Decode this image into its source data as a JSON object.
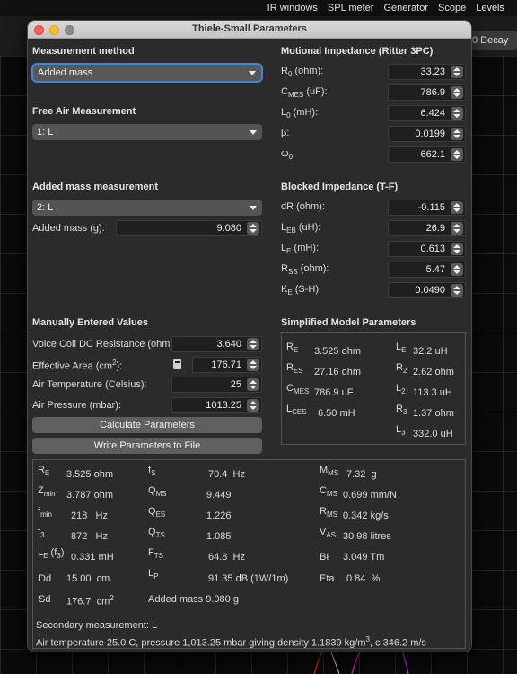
{
  "menubar": [
    "IR windows",
    "SPL meter",
    "Generator",
    "Scope",
    "Levels"
  ],
  "toolbar": {
    "decay_label": "0 Decay"
  },
  "dialog": {
    "title": "Thiele-Small Parameters",
    "measurement_method": {
      "heading": "Measurement method",
      "value": "Added mass"
    },
    "free_air": {
      "heading": "Free Air Measurement",
      "value": "1: L"
    },
    "added_mass": {
      "heading": "Added mass measurement",
      "value": "2: L",
      "mass_label": "Added mass (g):",
      "mass_value": "9.080"
    },
    "manual": {
      "heading": "Manually Entered Values",
      "dc_label": "Voice Coil DC Resistance (ohm):",
      "dc_value": "3.640",
      "area_label_pre": "Effective Area (cm",
      "area_label_sup": "2",
      "area_label_post": "):",
      "area_value": "176.71",
      "temp_label": "Air Temperature (Celsius):",
      "temp_value": "25",
      "pressure_label": "Air Pressure (mbar):",
      "pressure_value": "1013.25",
      "calc_button": "Calculate Parameters",
      "write_button": "Write Parameters to File"
    },
    "motional": {
      "heading": "Motional Impedance (Ritter 3PC)",
      "r0": {
        "pre": "R",
        "sub": "0",
        "post": " (ohm):",
        "value": "33.23"
      },
      "cmes": {
        "pre": "C",
        "sub": "MES",
        "post": " (uF):",
        "value": "786.9"
      },
      "l0": {
        "pre": "L",
        "sub": "0",
        "post": " (mH):",
        "value": "6.424"
      },
      "beta": {
        "pre": "β:",
        "sub": "",
        "post": "",
        "value": "0.0199"
      },
      "omega": {
        "pre": "ω",
        "sub": "0",
        "post": ":",
        "value": "662.1"
      }
    },
    "blocked": {
      "heading": "Blocked Impedance (T-F)",
      "dr": {
        "pre": "dR (ohm):",
        "sub": "",
        "post": "",
        "value": "-0.115"
      },
      "leb": {
        "pre": "L",
        "sub": "EB",
        "post": " (uH):",
        "value": "26.9"
      },
      "le": {
        "pre": "L",
        "sub": "E",
        "post": " (mH):",
        "value": "0.613"
      },
      "rss": {
        "pre": "R",
        "sub": "SS",
        "post": " (ohm):",
        "value": "5.47"
      },
      "ke": {
        "pre": "K",
        "sub": "E",
        "post": " (S-H):",
        "value": "0.0490"
      }
    },
    "simplified": {
      "heading": "Simplified Model Parameters",
      "re": {
        "pre": "R",
        "sub": "E",
        "value": "3.525",
        "unit": "ohm"
      },
      "res": {
        "pre": "R",
        "sub": "ES",
        "value": "27.16",
        "unit": "ohm"
      },
      "cmes": {
        "pre": "C",
        "sub": "MES",
        "value": "786.9",
        "unit": "uF"
      },
      "lces": {
        "pre": "L",
        "sub": "CES",
        "value": "6.50",
        "unit": "mH"
      },
      "le": {
        "pre": "L",
        "sub": "E",
        "value": "32.2",
        "unit": "uH"
      },
      "r2": {
        "pre": "R",
        "sub": "2",
        "value": "2.62",
        "unit": "ohm"
      },
      "l2": {
        "pre": "L",
        "sub": "2",
        "value": "113.3",
        "unit": "uH"
      },
      "r3": {
        "pre": "R",
        "sub": "3",
        "value": "1.37",
        "unit": "ohm"
      },
      "l3": {
        "pre": "L",
        "sub": "3",
        "value": "332.0",
        "unit": "uH"
      }
    },
    "results": {
      "re": {
        "pre": "R",
        "sub": "E",
        "value": "3.525",
        "unit": "ohm"
      },
      "zmin": {
        "pre": "Z",
        "sub": "min",
        "value": "3.787",
        "unit": "ohm"
      },
      "fmin": {
        "pre": "f",
        "sub": "min",
        "value": "218",
        "unit": "Hz"
      },
      "f3": {
        "pre": "f",
        "sub": "3",
        "value": "872",
        "unit": "Hz"
      },
      "lef3": {
        "pre": "L",
        "sub": "E",
        "mid": " (f",
        "sub2": "3",
        "post": ")",
        "value": "0.331",
        "unit": "mH"
      },
      "dd": {
        "pre": "Dd",
        "value": "15.00",
        "unit": "cm"
      },
      "sd": {
        "pre": "Sd",
        "value": "176.7",
        "unit_pre": "cm",
        "unit_sup": "2"
      },
      "fs": {
        "pre": "f",
        "sub": "S",
        "value": "70.4",
        "unit": "Hz"
      },
      "qms": {
        "pre": "Q",
        "sub": "MS",
        "value": "9.449"
      },
      "qes": {
        "pre": "Q",
        "sub": "ES",
        "value": "1.226"
      },
      "qts": {
        "pre": "Q",
        "sub": "TS",
        "value": "1.085"
      },
      "fts": {
        "pre": "F",
        "sub": "TS",
        "value": "64.8",
        "unit": "Hz"
      },
      "lp": {
        "pre": "L",
        "sub": "P",
        "value": "91.35",
        "unit": "dB (1W/1m)"
      },
      "added_mass": {
        "label": "Added mass",
        "value": "9.080",
        "unit": "g"
      },
      "mms": {
        "pre": "M",
        "sub": "MS",
        "value": "7.32",
        "unit": "g"
      },
      "cms": {
        "pre": "C",
        "sub": "MS",
        "value": "0.699",
        "unit": "mm/N"
      },
      "rms": {
        "pre": "R",
        "sub": "MS",
        "value": "0.342",
        "unit": "kg/s"
      },
      "vas": {
        "pre": "V",
        "sub": "AS",
        "value": "30.98",
        "unit": "litres"
      },
      "bl": {
        "pre": "Bℓ",
        "value": "3.049",
        "unit": "Tm"
      },
      "eta": {
        "pre": "Eta",
        "value": "0.84",
        "unit": "%"
      },
      "secondary": "Secondary measurement: L",
      "air_pre": "Air temperature 25.0 C, pressure 1,013.25 mbar giving density 1.1839 kg/m",
      "air_sup": "3",
      "air_post": ", c 346.2 m/s"
    }
  }
}
